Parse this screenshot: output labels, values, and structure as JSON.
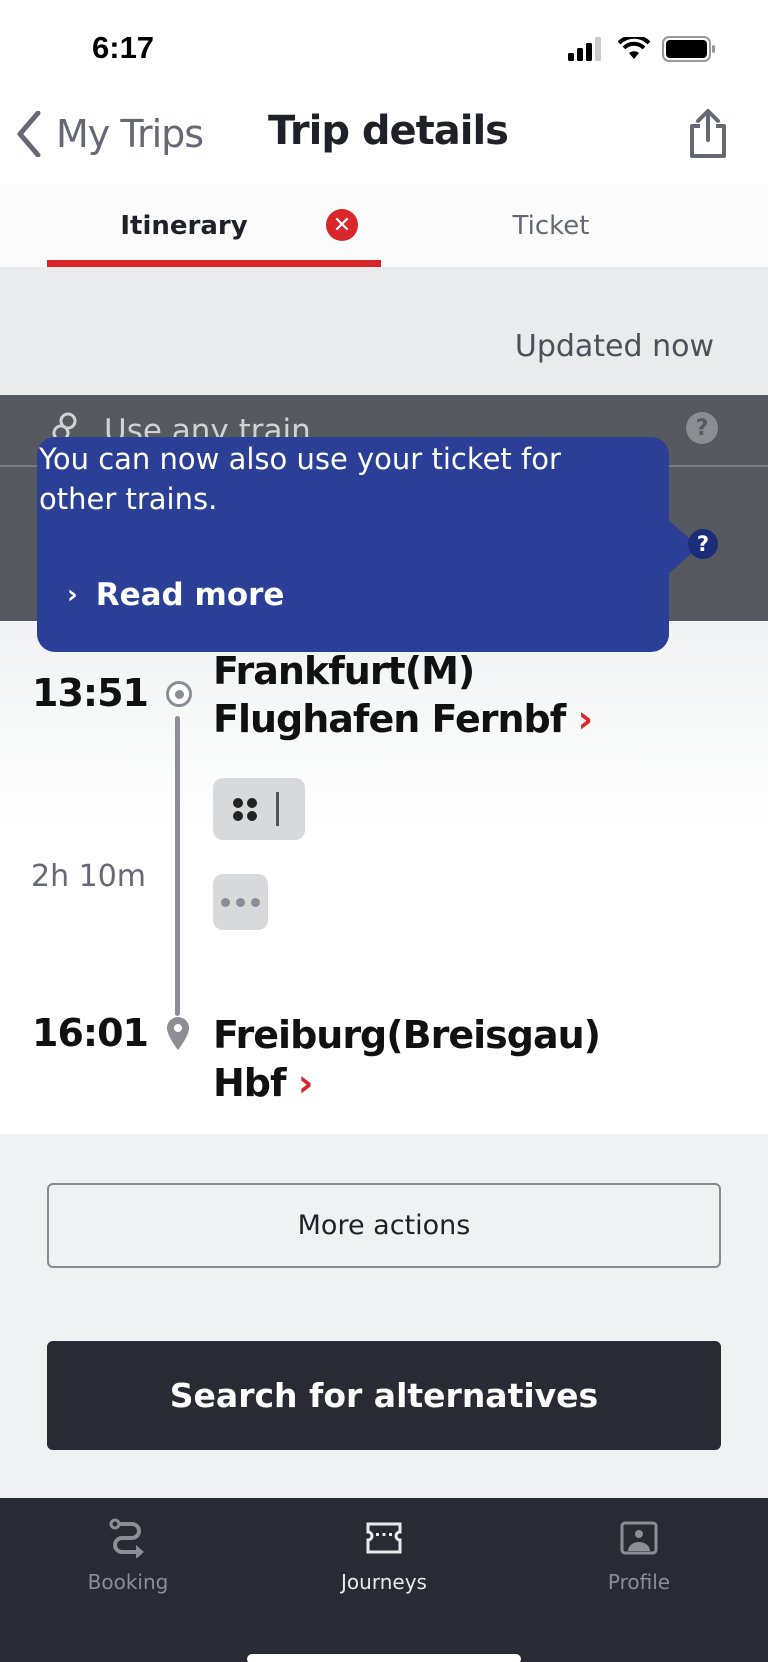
{
  "status_bar": {
    "time": "6:17"
  },
  "nav": {
    "back_label": "My Trips",
    "title": "Trip details"
  },
  "tabs": [
    {
      "label": "Itinerary",
      "active": true,
      "badge": "✕"
    },
    {
      "label": "Ticket",
      "active": false
    }
  ],
  "updated": "Updated now",
  "notice": {
    "label": "Use any train",
    "help": "?"
  },
  "tooltip": {
    "text": "You can now also use your ticket for other trains.",
    "link_label": "Read more",
    "link_chevron": "›",
    "anchor_help": "?"
  },
  "journey": {
    "departure": {
      "time": "13:51",
      "station_line1": "Frankfurt(M)",
      "station_line2": "Flughafen Fernbf"
    },
    "duration": "2h 10m",
    "arrival": {
      "time": "16:01",
      "station_line1": "Freiburg(Breisgau)",
      "station_line2": "Hbf"
    },
    "chevron": "›"
  },
  "actions": {
    "more_actions": "More actions",
    "search_alternatives": "Search for alternatives"
  },
  "tab_bar": [
    {
      "label": "Booking",
      "icon": "route-icon",
      "active": false
    },
    {
      "label": "Journeys",
      "icon": "ticket-icon",
      "active": true
    },
    {
      "label": "Profile",
      "icon": "profile-icon",
      "active": false
    }
  ],
  "colors": {
    "accent_red": "#d8262b",
    "tooltip_blue": "#2b3f96",
    "dark": "#282b34"
  }
}
